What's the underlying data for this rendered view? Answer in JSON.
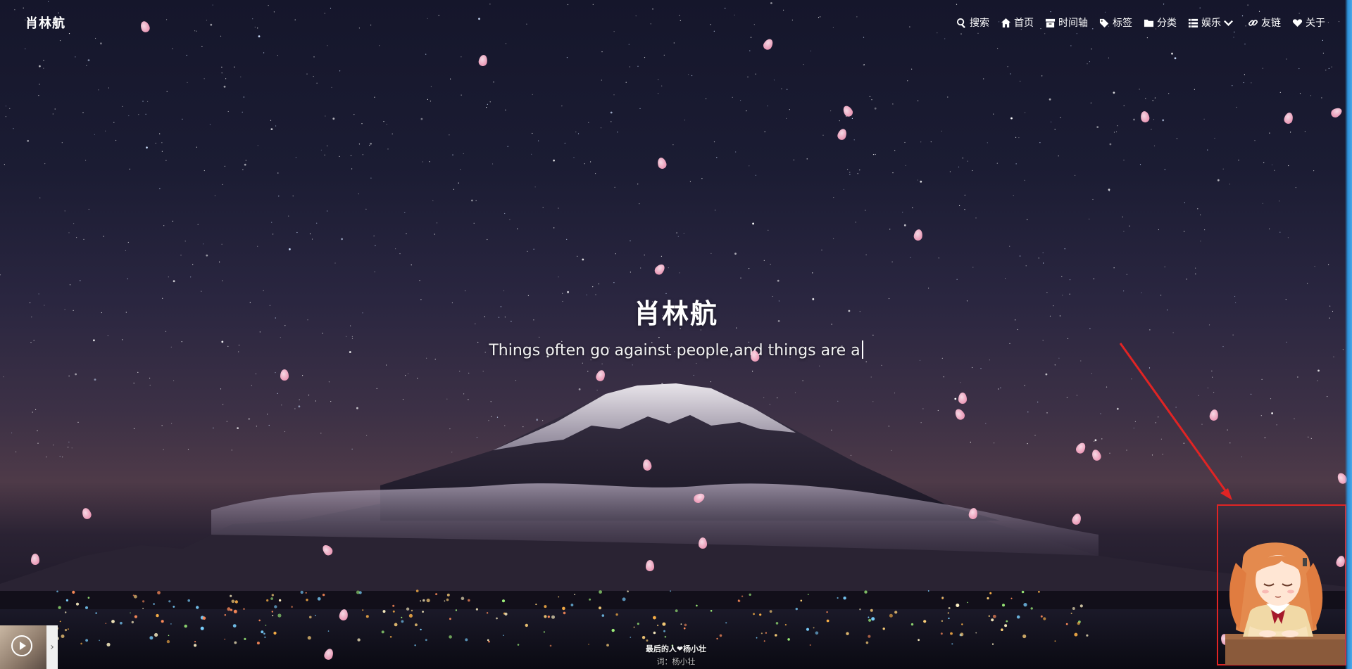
{
  "site": {
    "logo": "肖林航"
  },
  "nav": [
    {
      "key": "search",
      "label": "搜索",
      "icon": "search-icon"
    },
    {
      "key": "home",
      "label": "首页",
      "icon": "home-icon"
    },
    {
      "key": "timeline",
      "label": "时间轴",
      "icon": "archive-icon"
    },
    {
      "key": "tags",
      "label": "标签",
      "icon": "tags-icon"
    },
    {
      "key": "categories",
      "label": "分类",
      "icon": "folder-icon"
    },
    {
      "key": "entertainment",
      "label": "娱乐",
      "icon": "list-icon"
    },
    {
      "key": "links",
      "label": "友链",
      "icon": "link-icon"
    },
    {
      "key": "about",
      "label": "关于",
      "icon": "heart-icon"
    }
  ],
  "hero": {
    "title": "肖林航",
    "subtitle": "Things often go against people,and things are a"
  },
  "music": {
    "lyric": "最后的人❤杨小壮",
    "credit": "词：杨小壮"
  },
  "annotation": {
    "color": "#e02424"
  },
  "colors": {
    "petal": "#f7a9c4",
    "sky_top": "#15162b",
    "accent_scroll": "#2b8fd6"
  }
}
